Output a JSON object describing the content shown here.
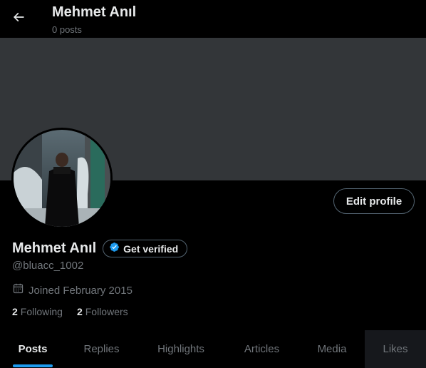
{
  "header": {
    "title": "Mehmet Anıl",
    "subtitle": "0 posts",
    "back_icon": "arrow-left-icon"
  },
  "profile": {
    "display_name": "Mehmet Anıl",
    "verify_label": "Get verified",
    "verify_icon": "verified-badge-icon",
    "handle": "@bluacc_1002",
    "joined": "Joined February 2015",
    "joined_icon": "calendar-icon",
    "edit_label": "Edit profile",
    "following_count": "2",
    "following_label": "Following",
    "followers_count": "2",
    "followers_label": "Followers"
  },
  "tabs": [
    {
      "label": "Posts",
      "active": true
    },
    {
      "label": "Replies"
    },
    {
      "label": "Highlights"
    },
    {
      "label": "Articles"
    },
    {
      "label": "Media"
    },
    {
      "label": "Likes"
    }
  ],
  "colors": {
    "background": "#000000",
    "banner": "#333639",
    "accent": "#1d9bf0",
    "secondary_text": "#71767b",
    "border": "#536471"
  }
}
